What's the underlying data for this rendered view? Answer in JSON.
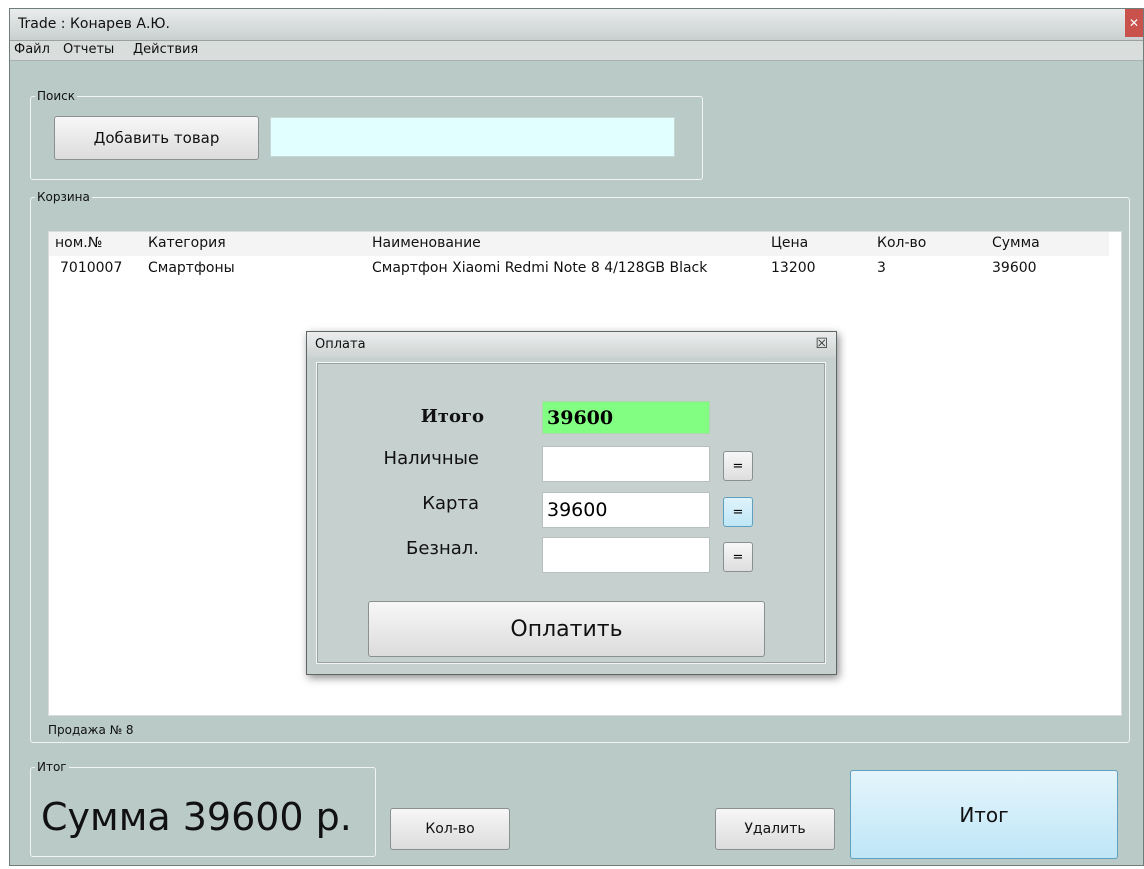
{
  "window": {
    "title": "Trade : Конарев А.Ю.",
    "close_symbol": "✕"
  },
  "menu": {
    "items": [
      "Файл",
      "Отчеты",
      "Действия"
    ]
  },
  "search": {
    "group_title": "Поиск",
    "add_button": "Добавить товар",
    "input_value": ""
  },
  "cart": {
    "group_title": "Корзина",
    "columns": [
      "ном.№",
      "Категория",
      "Наименование",
      "Цена",
      "Кол-во",
      "Сумма"
    ],
    "rows": [
      [
        "7010007",
        "Смартфоны",
        "Смартфон Xiaomi Redmi Note 8 4/128GB Black",
        "13200",
        "3",
        "39600"
      ]
    ],
    "sale_number": "Продажа № 8"
  },
  "payment_dialog": {
    "title": "Оплата",
    "close_symbol": "☒",
    "total_label": "Итого",
    "total_value": "39600",
    "cash_label": "Наличные",
    "cash_value": "",
    "card_label": "Карта",
    "card_value": "39600",
    "noncash_label": "Безнал.",
    "noncash_value": "",
    "equals_symbol": "=",
    "pay_button": "Оплатить"
  },
  "total": {
    "group_title": "Итог",
    "sum_text": "Сумма 39600 р.",
    "qty_button": "Кол-во",
    "delete_button": "Удалить",
    "total_button": "Итог"
  },
  "colors": {
    "window_bg": "#b9cac7",
    "search_field_bg": "#e2ffff",
    "total_field_bg": "#82ff82",
    "active_button": "#bfe6f7"
  }
}
